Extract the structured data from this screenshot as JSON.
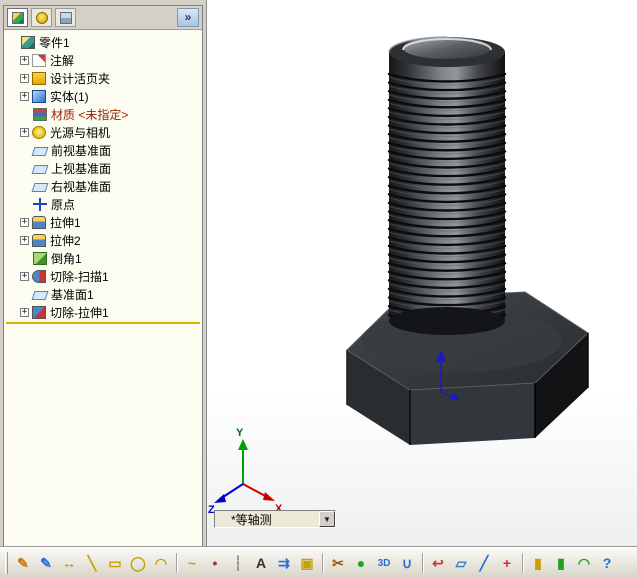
{
  "panel": {
    "chevron_label": "»",
    "tabs": [
      "featuremanager",
      "propertymanager",
      "configurationmanager"
    ]
  },
  "tree": {
    "expander_glyph": "+",
    "items": [
      {
        "name": "part-root",
        "label": "零件1",
        "icon": "part",
        "plus": false,
        "indent": 0
      },
      {
        "name": "annotations",
        "label": "注解",
        "icon": "annotations",
        "plus": true,
        "indent": 1
      },
      {
        "name": "design-binder",
        "label": "设计活页夹",
        "icon": "design-binder",
        "plus": true,
        "indent": 1
      },
      {
        "name": "solid-bodies",
        "label": "实体(1)",
        "icon": "solid-bodies",
        "plus": true,
        "indent": 1
      },
      {
        "name": "material",
        "label": "材质 <未指定>",
        "icon": "material",
        "plus": false,
        "indent": 1,
        "em": true
      },
      {
        "name": "lights-cameras",
        "label": "光源与相机",
        "icon": "lights",
        "plus": true,
        "indent": 1
      },
      {
        "name": "front-plane",
        "label": "前视基准面",
        "icon": "plane",
        "plus": false,
        "indent": 1
      },
      {
        "name": "top-plane",
        "label": "上视基准面",
        "icon": "plane",
        "plus": false,
        "indent": 1
      },
      {
        "name": "right-plane",
        "label": "右视基准面",
        "icon": "plane",
        "plus": false,
        "indent": 1
      },
      {
        "name": "origin",
        "label": "原点",
        "icon": "origin",
        "plus": false,
        "indent": 1
      },
      {
        "name": "extrude1",
        "label": "拉伸1",
        "icon": "extrude",
        "plus": true,
        "indent": 1
      },
      {
        "name": "extrude2",
        "label": "拉伸2",
        "icon": "extrude",
        "plus": true,
        "indent": 1
      },
      {
        "name": "chamfer1",
        "label": "倒角1",
        "icon": "chamfer",
        "plus": false,
        "indent": 1
      },
      {
        "name": "cut-sweep1",
        "label": "切除-扫描1",
        "icon": "cut-sweep",
        "plus": true,
        "indent": 1
      },
      {
        "name": "plane1",
        "label": "基准面1",
        "icon": "plane",
        "plus": false,
        "indent": 1
      },
      {
        "name": "cut-extrude1",
        "label": "切除-拉伸1",
        "icon": "cut-extrude",
        "plus": true,
        "indent": 1
      }
    ]
  },
  "viewport": {
    "view_label": "*等轴测",
    "triad": {
      "x": "X",
      "y": "Y",
      "z": "Z"
    },
    "model": "hex-bolt"
  },
  "toolbar": {
    "items": [
      {
        "name": "sketch",
        "glyph": "✎",
        "color": "#cc7a00"
      },
      {
        "name": "3d-sketch",
        "glyph": "✎",
        "color": "#2a6fd6"
      },
      {
        "name": "smart-dimension",
        "glyph": "↔",
        "color": "#b8860b"
      },
      {
        "name": "line",
        "glyph": "╲",
        "color": "#c8a000"
      },
      {
        "name": "rectangle",
        "glyph": "▭",
        "color": "#c8a000"
      },
      {
        "name": "circle",
        "glyph": "◯",
        "color": "#c8a000"
      },
      {
        "name": "arc",
        "glyph": "◠",
        "color": "#c8a000"
      },
      {
        "sep": true
      },
      {
        "name": "spline",
        "glyph": "~",
        "color": "#c8a000"
      },
      {
        "name": "point",
        "glyph": "•",
        "color": "#aa3333"
      },
      {
        "name": "centerline",
        "glyph": "┆",
        "color": "#888888"
      },
      {
        "name": "text",
        "glyph": "A",
        "color": "#333333"
      },
      {
        "name": "convert-entities",
        "glyph": "⇉",
        "color": "#2a6fd6"
      },
      {
        "name": "mirror",
        "glyph": "▣",
        "color": "#c8a000"
      },
      {
        "sep": true
      },
      {
        "name": "trim",
        "glyph": "✂",
        "color": "#aa5500"
      },
      {
        "name": "sphere",
        "glyph": "●",
        "color": "#1fa21f"
      },
      {
        "name": "3d-view",
        "glyph": "3D",
        "color": "#2a6fd6",
        "small": true
      },
      {
        "name": "u-shape",
        "glyph": "∪",
        "color": "#2a6fd6"
      },
      {
        "sep": true
      },
      {
        "name": "exit-sketch",
        "glyph": "↩",
        "color": "#cc3333"
      },
      {
        "name": "plane",
        "glyph": "▱",
        "color": "#3a7bbf"
      },
      {
        "name": "axis",
        "glyph": "╱",
        "color": "#2a6fd6"
      },
      {
        "name": "coordinate-system",
        "glyph": "+",
        "color": "#cc3333"
      },
      {
        "sep": true
      },
      {
        "name": "extrude-boss",
        "glyph": "▮",
        "color": "#c8a000"
      },
      {
        "name": "extrude-cut",
        "glyph": "▮",
        "color": "#1fa21f"
      },
      {
        "name": "fillet",
        "glyph": "◠",
        "color": "#1fa21f"
      },
      {
        "name": "help",
        "glyph": "?",
        "color": "#2a6fd6"
      }
    ]
  }
}
